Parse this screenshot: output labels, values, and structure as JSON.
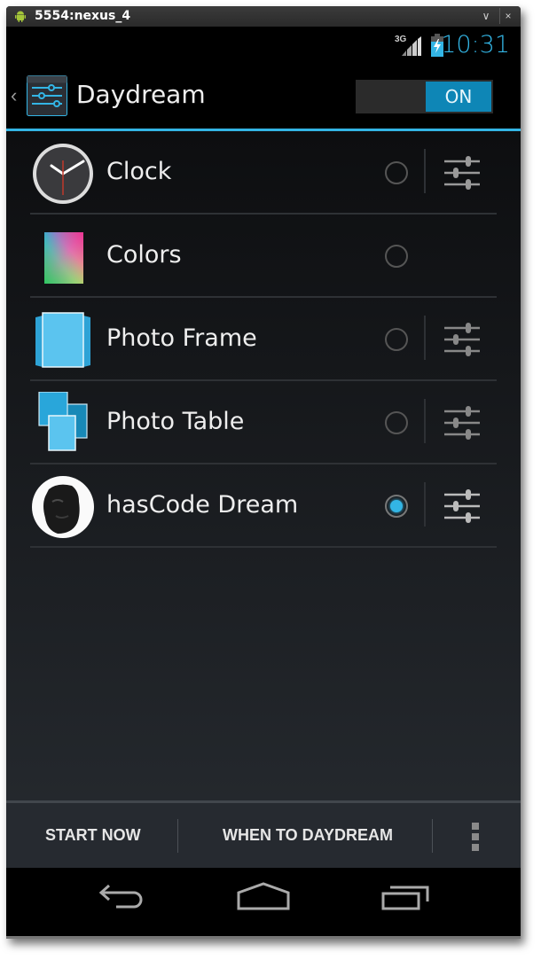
{
  "window": {
    "title": "5554:nexus_4",
    "minimize_label": "∨",
    "close_label": "×"
  },
  "status_bar": {
    "network_type": "3G",
    "time": "10:31",
    "icons": [
      "signal-icon",
      "battery-charging-icon"
    ]
  },
  "action_bar": {
    "back_caret": "‹",
    "title": "Daydream",
    "toggle_label": "ON",
    "toggle_state": true
  },
  "colors": {
    "accent": "#33b5e5",
    "toggle_on": "#0e86b6",
    "background_top": "#0d0e10",
    "background_bottom": "#24282d",
    "bottom_bar": "#262a30"
  },
  "dreams": [
    {
      "label": "Clock",
      "icon": "clock-icon",
      "selected": false,
      "has_settings": true
    },
    {
      "label": "Colors",
      "icon": "colors-icon",
      "selected": false,
      "has_settings": false
    },
    {
      "label": "Photo Frame",
      "icon": "photo-frame-icon",
      "selected": false,
      "has_settings": true
    },
    {
      "label": "Photo Table",
      "icon": "photo-table-icon",
      "selected": false,
      "has_settings": true
    },
    {
      "label": "hasCode Dream",
      "icon": "hascode-avatar-icon",
      "selected": true,
      "has_settings": true
    }
  ],
  "bottom_bar": {
    "start_now": "START NOW",
    "when_to_daydream": "WHEN TO DAYDREAM",
    "overflow": "overflow-menu-icon"
  },
  "nav_bar": {
    "buttons": [
      "back-icon",
      "home-icon",
      "recents-icon"
    ]
  }
}
